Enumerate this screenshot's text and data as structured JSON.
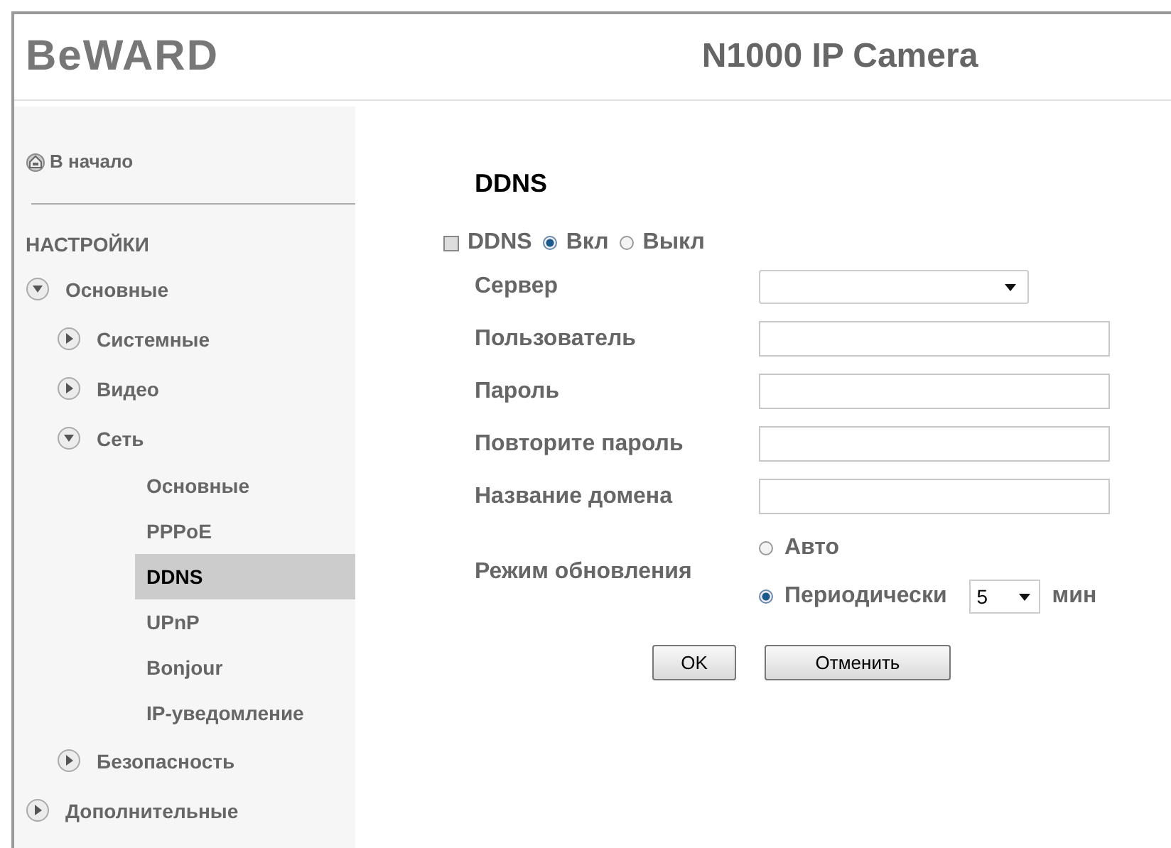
{
  "header": {
    "logo": "BeWARD",
    "title": "N1000 IP Camera"
  },
  "sidebar": {
    "home": "В начало",
    "section": "НАСТРОЙКИ",
    "tree": [
      {
        "label": "Основные",
        "expanded": true,
        "children": [
          {
            "label": "Системные",
            "expanded": false
          },
          {
            "label": "Видео",
            "expanded": false
          },
          {
            "label": "Сеть",
            "expanded": true,
            "children": [
              {
                "label": "Основные",
                "selected": false
              },
              {
                "label": "PPPoE",
                "selected": false
              },
              {
                "label": "DDNS",
                "selected": true
              },
              {
                "label": "UPnP",
                "selected": false
              },
              {
                "label": "Bonjour",
                "selected": false
              },
              {
                "label": "IP-уведомление",
                "selected": false
              }
            ]
          },
          {
            "label": "Безопасность",
            "expanded": false
          }
        ]
      },
      {
        "label": "Дополнительные",
        "expanded": false
      }
    ]
  },
  "page": {
    "title": "DDNS",
    "ddns": {
      "label": "DDNS",
      "options": [
        {
          "label": "Вкл",
          "selected": true
        },
        {
          "label": "Выкл",
          "selected": false
        }
      ]
    },
    "fields": [
      {
        "kind": "select",
        "label": "Сервер"
      },
      {
        "kind": "text",
        "label": "Пользователь"
      },
      {
        "kind": "text",
        "label": "Пароль"
      },
      {
        "kind": "text",
        "label": "Повторите пароль"
      },
      {
        "kind": "text",
        "label": "Название домена"
      }
    ],
    "update_mode": {
      "label": "Режим обновления",
      "options": [
        {
          "label": "Авто",
          "selected": false
        },
        {
          "label": "Периодически",
          "selected": true,
          "interval": "5",
          "unit": "мин"
        }
      ]
    },
    "buttons": [
      "OK",
      "Отменить"
    ]
  }
}
